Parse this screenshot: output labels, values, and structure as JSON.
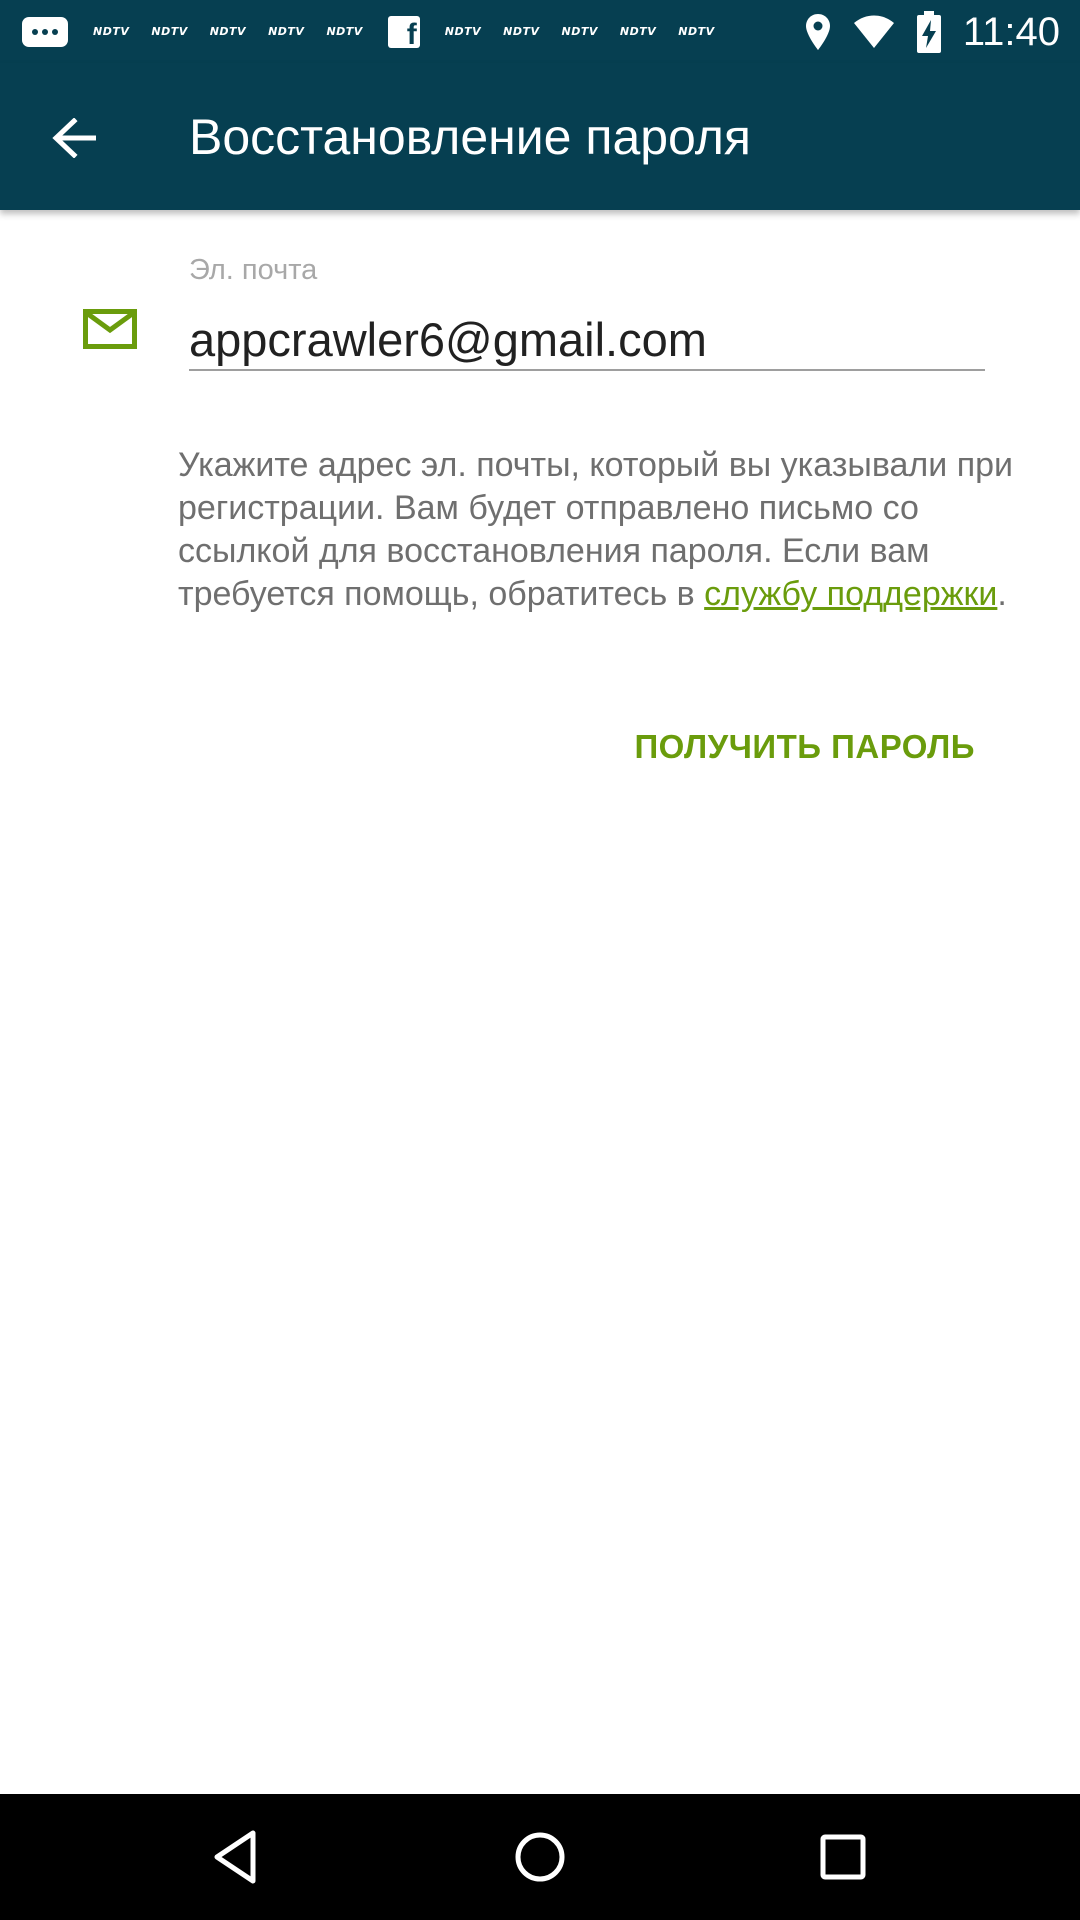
{
  "status_bar": {
    "notification_labels": [
      "NDTV",
      "NDTV",
      "NDTV",
      "NDTV",
      "NDTV",
      "NDTV",
      "NDTV",
      "NDTV",
      "NDTV",
      "NDTV"
    ],
    "time": "11:40"
  },
  "app_bar": {
    "title": "Восстановление пароля",
    "background_color": "#063f51"
  },
  "form": {
    "email_label": "Эл. почта",
    "email_value": "appcrawler6@gmail.com",
    "help_text_before_link": "Укажите адрес эл. почты, который вы указывали при регистрации. Вам будет отправлено письмо со ссылкой для восстановления пароля. Если вам требуется помощь, обратитесь в ",
    "support_link": "службу поддержки",
    "help_text_after_link": ".",
    "submit_label": "ПОЛУЧИТЬ ПАРОЛЬ",
    "accent_color": "#6a9c0c"
  },
  "icons": {
    "back": "arrow-back-icon",
    "email": "mail-icon",
    "nav_back": "nav-back-icon",
    "nav_home": "nav-home-icon",
    "nav_recents": "nav-recents-icon"
  }
}
